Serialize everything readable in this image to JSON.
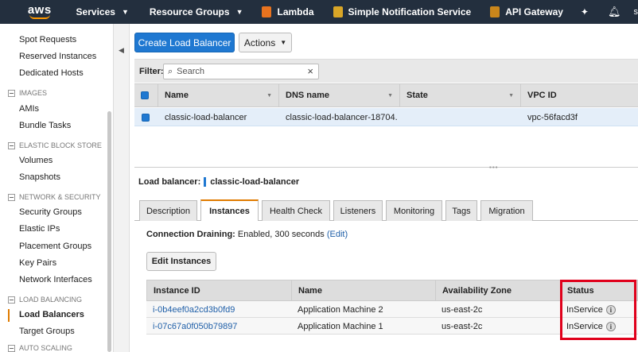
{
  "topnav": {
    "logo": "aws",
    "services": "Services",
    "resource_groups": "Resource Groups",
    "shortcuts": [
      {
        "label": "Lambda",
        "color": "#e8731f"
      },
      {
        "label": "Simple Notification Service",
        "color": "#d9a627"
      },
      {
        "label": "API Gateway",
        "color": "#c9861b"
      }
    ],
    "account": "s"
  },
  "sidebar": {
    "items": [
      {
        "label": "Spot Requests",
        "type": "item"
      },
      {
        "label": "Reserved Instances",
        "type": "item"
      },
      {
        "label": "Dedicated Hosts",
        "type": "item"
      },
      {
        "label": "IMAGES",
        "type": "head"
      },
      {
        "label": "AMIs",
        "type": "item"
      },
      {
        "label": "Bundle Tasks",
        "type": "item"
      },
      {
        "label": "ELASTIC BLOCK STORE",
        "type": "head"
      },
      {
        "label": "Volumes",
        "type": "item"
      },
      {
        "label": "Snapshots",
        "type": "item"
      },
      {
        "label": "NETWORK & SECURITY",
        "type": "head"
      },
      {
        "label": "Security Groups",
        "type": "item"
      },
      {
        "label": "Elastic IPs",
        "type": "item"
      },
      {
        "label": "Placement Groups",
        "type": "item"
      },
      {
        "label": "Key Pairs",
        "type": "item"
      },
      {
        "label": "Network Interfaces",
        "type": "item"
      },
      {
        "label": "LOAD BALANCING",
        "type": "head"
      },
      {
        "label": "Load Balancers",
        "type": "item",
        "active": true
      },
      {
        "label": "Target Groups",
        "type": "item"
      },
      {
        "label": "AUTO SCALING",
        "type": "head"
      }
    ]
  },
  "toolbar": {
    "create_label": "Create Load Balancer",
    "actions_label": "Actions"
  },
  "filter": {
    "label": "Filter:",
    "placeholder": "Search"
  },
  "lb_table": {
    "columns": [
      "Name",
      "DNS name",
      "State",
      "VPC ID"
    ],
    "rows": [
      {
        "name": "classic-load-balancer",
        "dns": "classic-load-balancer-18704...",
        "state": "",
        "vpc": "vpc-56facd3f"
      }
    ]
  },
  "detail": {
    "title_label": "Load balancer:",
    "title_value": "classic-load-balancer",
    "tabs": [
      "Description",
      "Instances",
      "Health Check",
      "Listeners",
      "Monitoring",
      "Tags",
      "Migration"
    ],
    "active_tab": "Instances",
    "draining_label": "Connection Draining:",
    "draining_value": "Enabled, 300 seconds",
    "draining_edit": "(Edit)",
    "edit_instances_label": "Edit Instances"
  },
  "instances": {
    "columns": [
      "Instance ID",
      "Name",
      "Availability Zone",
      "Status"
    ],
    "rows": [
      {
        "id": "i-0b4eef0a2cd3b0fd9",
        "name": "Application Machine 2",
        "zone": "us-east-2c",
        "status": "InService"
      },
      {
        "id": "i-07c67a0f050b79897",
        "name": "Application Machine 1",
        "zone": "us-east-2c",
        "status": "InService"
      }
    ]
  },
  "colors": {
    "nav_bg": "#232f3e",
    "primary": "#1f78d1",
    "accent": "#e07b00",
    "highlight": "#e0001b"
  }
}
